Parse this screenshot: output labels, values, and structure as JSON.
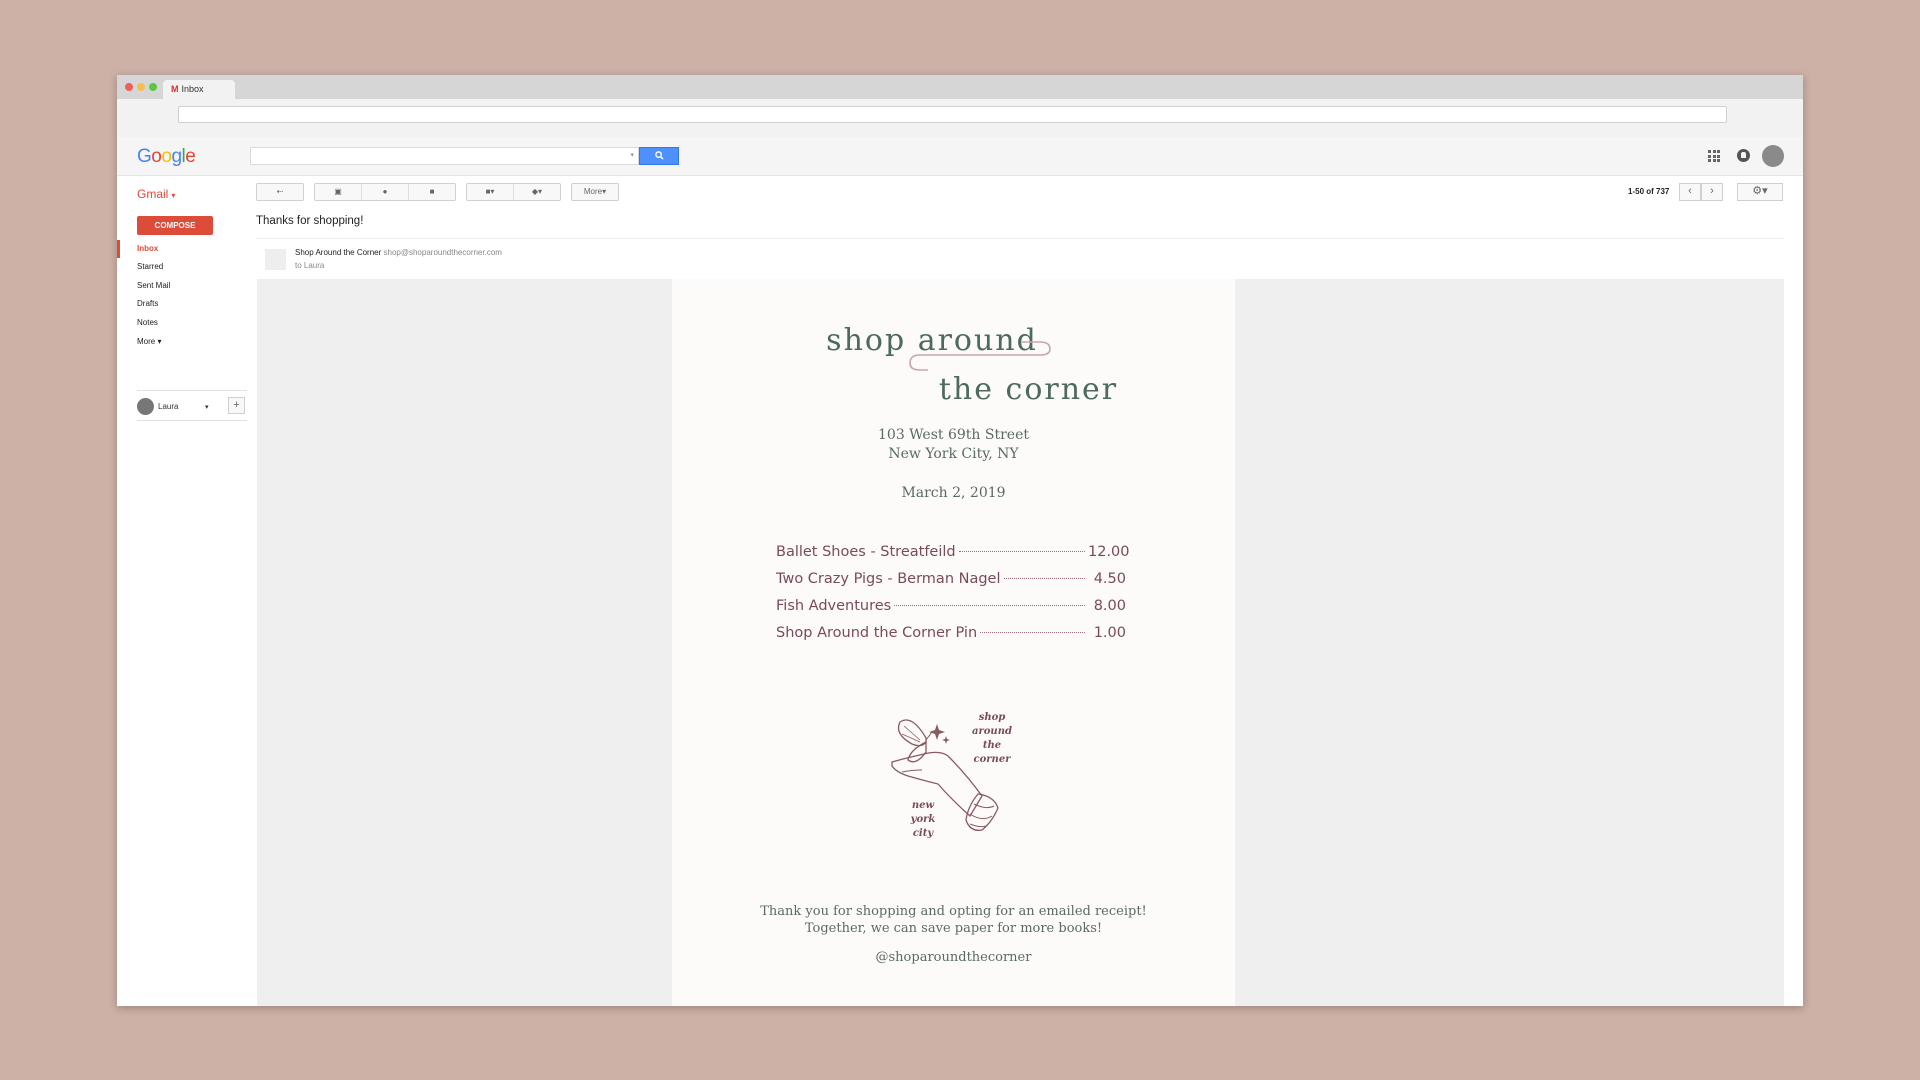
{
  "browser": {
    "tab_title": "Inbox",
    "tab_icon": "gmail-m-icon"
  },
  "header": {
    "logo": [
      "G",
      "o",
      "o",
      "g",
      "l",
      "e"
    ],
    "logo_colors": [
      "#4285f4",
      "#ea4335",
      "#fbbc05",
      "#4285f4",
      "#34a853",
      "#ea4335"
    ],
    "search_placeholder": "",
    "search_icon": "search-icon"
  },
  "toolbar": {
    "gmail_label": "Gmail",
    "more_label": "More",
    "pager": "1-50 of 737"
  },
  "sidebar": {
    "compose_label": "COMPOSE",
    "items": [
      {
        "label": "Inbox",
        "active": true
      },
      {
        "label": "Starred",
        "active": false
      },
      {
        "label": "Sent Mail",
        "active": false
      },
      {
        "label": "Drafts",
        "active": false
      },
      {
        "label": "Notes",
        "active": false
      },
      {
        "label": "More",
        "active": false
      }
    ],
    "hangout_user": "Laura"
  },
  "message": {
    "subject": "Thanks for shopping!",
    "sender_name": "Shop Around the Corner",
    "sender_email": "shop@shoparoundthecorner.com",
    "to_line": "to Laura"
  },
  "receipt": {
    "logo_line1": "shop around",
    "logo_line2": "the corner",
    "address_line1": "103 West 69th Street",
    "address_line2": "New York City, NY",
    "date": "March 2, 2019",
    "items": [
      {
        "name": "Ballet Shoes - Streatfeild",
        "price": "12.00"
      },
      {
        "name": "Two Crazy Pigs - Berman Nagel",
        "price": "4.50"
      },
      {
        "name": "Fish Adventures",
        "price": "8.00"
      },
      {
        "name": "Shop Around the Corner Pin",
        "price": "1.00"
      }
    ],
    "emblem_text_top": [
      "shop",
      "around",
      "the",
      "corner"
    ],
    "emblem_text_bottom": [
      "new",
      "york",
      "city"
    ],
    "thanks_line1": "Thank you for shopping and opting for an emailed receipt!",
    "thanks_line2": "Together, we can save paper for more books!",
    "handle": "@shoparoundthecorner"
  },
  "colors": {
    "page_bg": "#cdb0a6",
    "gmail_red": "#dd4b39",
    "search_blue": "#4d90fe",
    "logo_green": "#4c6a5d",
    "item_rose": "#7a4b55"
  }
}
